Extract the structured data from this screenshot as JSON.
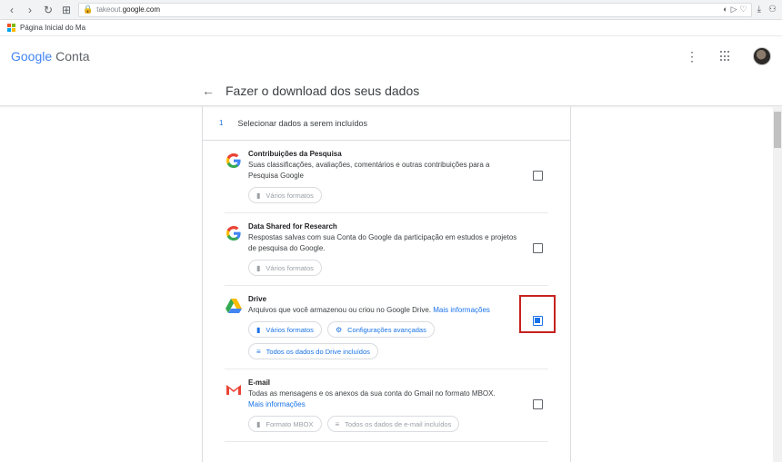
{
  "browser": {
    "url_gray": "takeout.",
    "url_domain": "google.com",
    "bookmark_label": "Página Inicial do Ma"
  },
  "header": {
    "logo_google": "Google",
    "logo_conta": "Conta"
  },
  "page": {
    "title": "Fazer o download dos seus dados"
  },
  "step": {
    "number": "1",
    "label": "Selecionar dados a serem incluídos"
  },
  "items": [
    {
      "name": "Contribuições da Pesquisa",
      "desc": "Suas classificações, avaliações, comentários e outras contribuições para a Pesquisa Google",
      "chips": [
        "Vários formatos"
      ],
      "checked": false
    },
    {
      "name": "Data Shared for Research",
      "desc": "Respostas salvas com sua Conta do Google da participação em estudos e projetos de pesquisa do Google.",
      "chips": [
        "Vários formatos"
      ],
      "checked": false
    },
    {
      "name": "Drive",
      "desc": "Arquivos que você armazenou ou criou no Google Drive.",
      "link": "Mais informações",
      "chips": [
        "Vários formatos",
        "Configurações avançadas",
        "Todos os dados do Drive incluídos"
      ],
      "checked": true
    },
    {
      "name": "E-mail",
      "desc": "Todas as mensagens e os anexos da sua conta do Gmail no formato MBOX.",
      "link": "Mais informações",
      "chips": [
        "Formato MBOX",
        "Todos os dados de e-mail incluídos"
      ],
      "checked": false
    }
  ],
  "colors": {
    "accent": "#1a73e8",
    "highlight": "#c5221f"
  }
}
